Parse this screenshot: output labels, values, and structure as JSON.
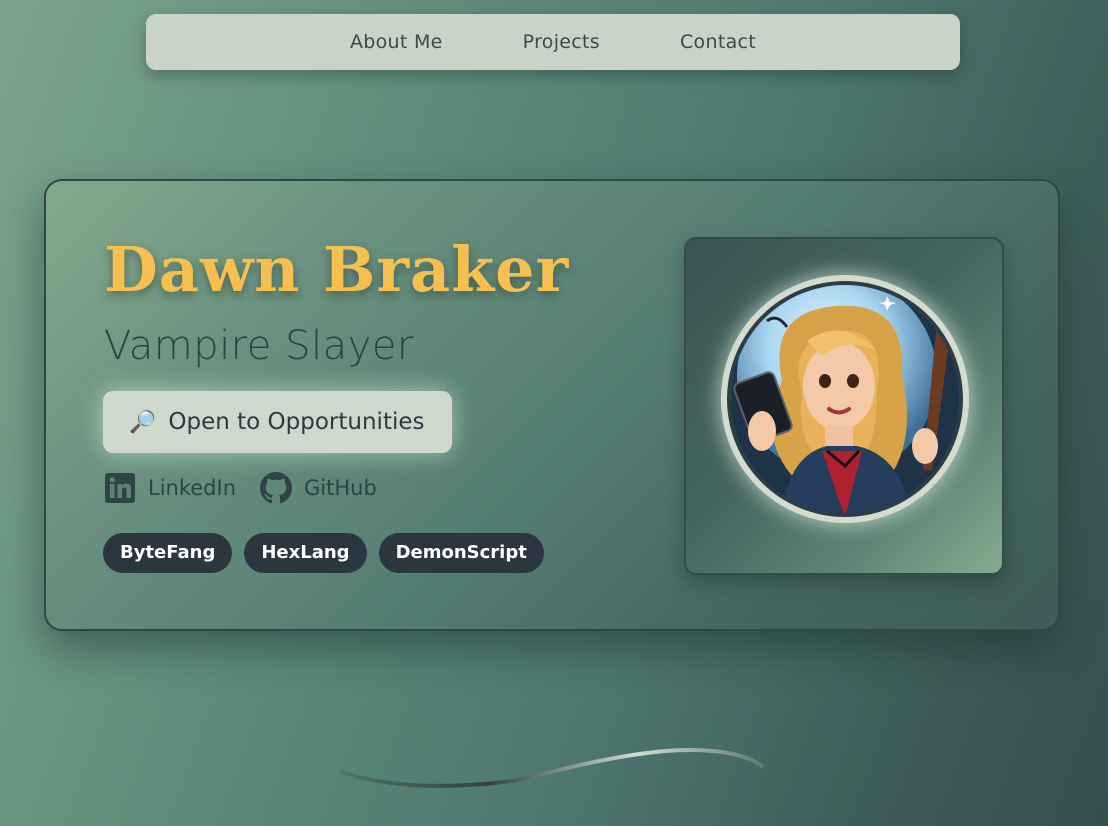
{
  "nav": {
    "items": [
      {
        "label": "About Me"
      },
      {
        "label": "Projects"
      },
      {
        "label": "Contact"
      }
    ]
  },
  "profile": {
    "name": "Dawn Braker",
    "role": "Vampire Slayer",
    "status_button": {
      "icon": "magnifying-glass-icon",
      "label": "Open to Opportunities"
    },
    "socials": [
      {
        "icon": "linkedin-icon",
        "label": "LinkedIn"
      },
      {
        "icon": "github-icon",
        "label": "GitHub"
      }
    ],
    "tags": [
      "ByteFang",
      "HexLang",
      "DemonScript"
    ],
    "avatar": {
      "icon": "avatar-illustration"
    }
  },
  "colors": {
    "name": "#f5c04f",
    "role": "#2e4246",
    "tag_bg": "#2c3640",
    "nav_bg": "#cad3c8",
    "button_bg": "#cfd8cc"
  }
}
